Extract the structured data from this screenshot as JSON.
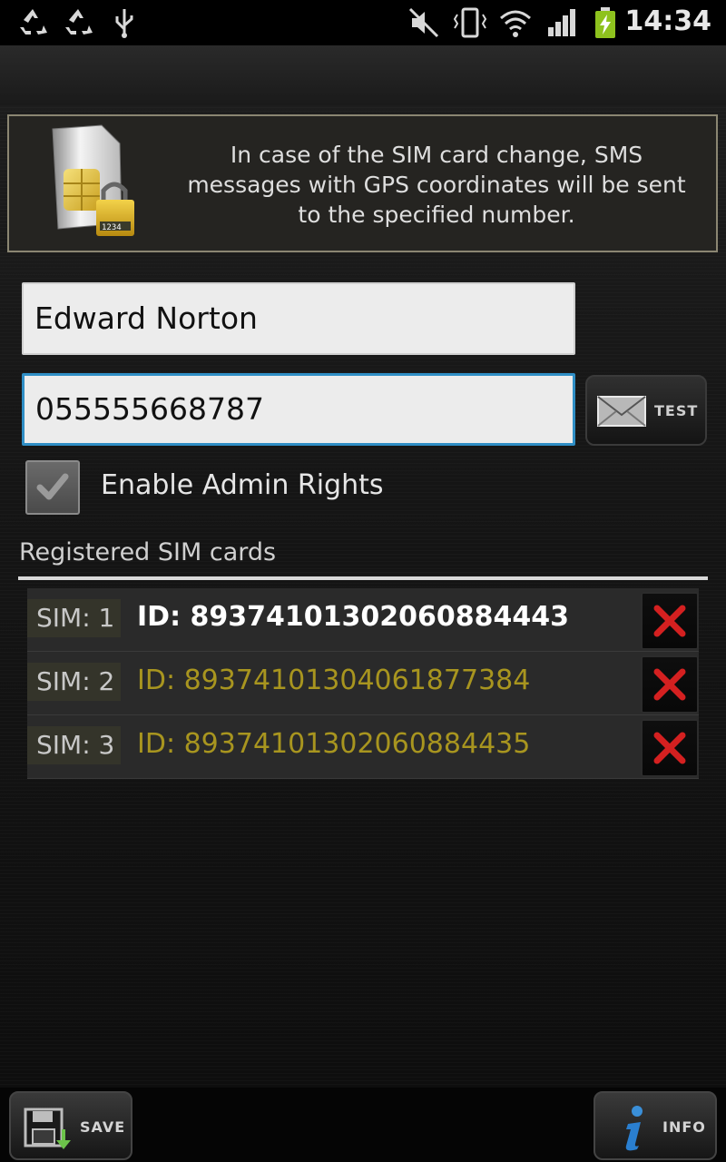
{
  "status_bar": {
    "time": "14:34",
    "icons": [
      "recycle-icon",
      "recycle-icon",
      "usb-icon",
      "mute-icon",
      "vibrate-icon",
      "wifi-icon",
      "signal-icon",
      "battery-charging-icon"
    ]
  },
  "info": {
    "message": "In case of the SIM card change, SMS messages with GPS coordinates will be sent to the specified number.",
    "icon": "sim-lock-icon",
    "lock_code": "1234"
  },
  "form": {
    "name_value": "Edward Norton",
    "phone_value": "055555668787",
    "test_label": "TEST",
    "admin_label": "Enable Admin Rights",
    "admin_checked": true
  },
  "sims": {
    "title": "Registered SIM cards",
    "items": [
      {
        "label": "SIM: 1",
        "id": "ID: 89374101302060884443",
        "active": true
      },
      {
        "label": "SIM: 2",
        "id": "ID: 89374101304061877384",
        "active": false
      },
      {
        "label": "SIM: 3",
        "id": "ID: 89374101302060884435",
        "active": false
      }
    ]
  },
  "bottom": {
    "save_label": "SAVE",
    "info_label": "INFO"
  },
  "colors": {
    "accent_focus": "#2f8ec5",
    "inactive_id": "#a8951f",
    "delete_red": "#d42020"
  }
}
